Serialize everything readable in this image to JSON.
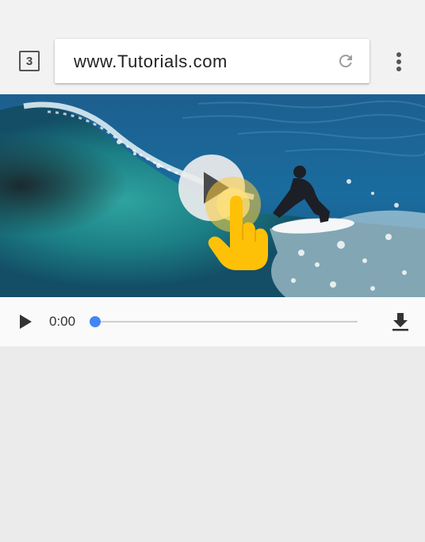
{
  "browser": {
    "tab_count": "3",
    "url": "www.Tutorials.com",
    "reload_icon": "reload-icon",
    "menu_icon": "more-vert-icon"
  },
  "video": {
    "overlay_icon": "play-icon",
    "gesture_icon": "tap-hand-icon"
  },
  "controls": {
    "play_icon": "play-icon",
    "time": "0:00",
    "progress": 0,
    "download_icon": "download-icon"
  },
  "colors": {
    "toolbar_bg": "#f2f2f2",
    "page_bg": "#ebebeb",
    "progress_accent": "#4285f4",
    "hand": "#ffc107"
  }
}
